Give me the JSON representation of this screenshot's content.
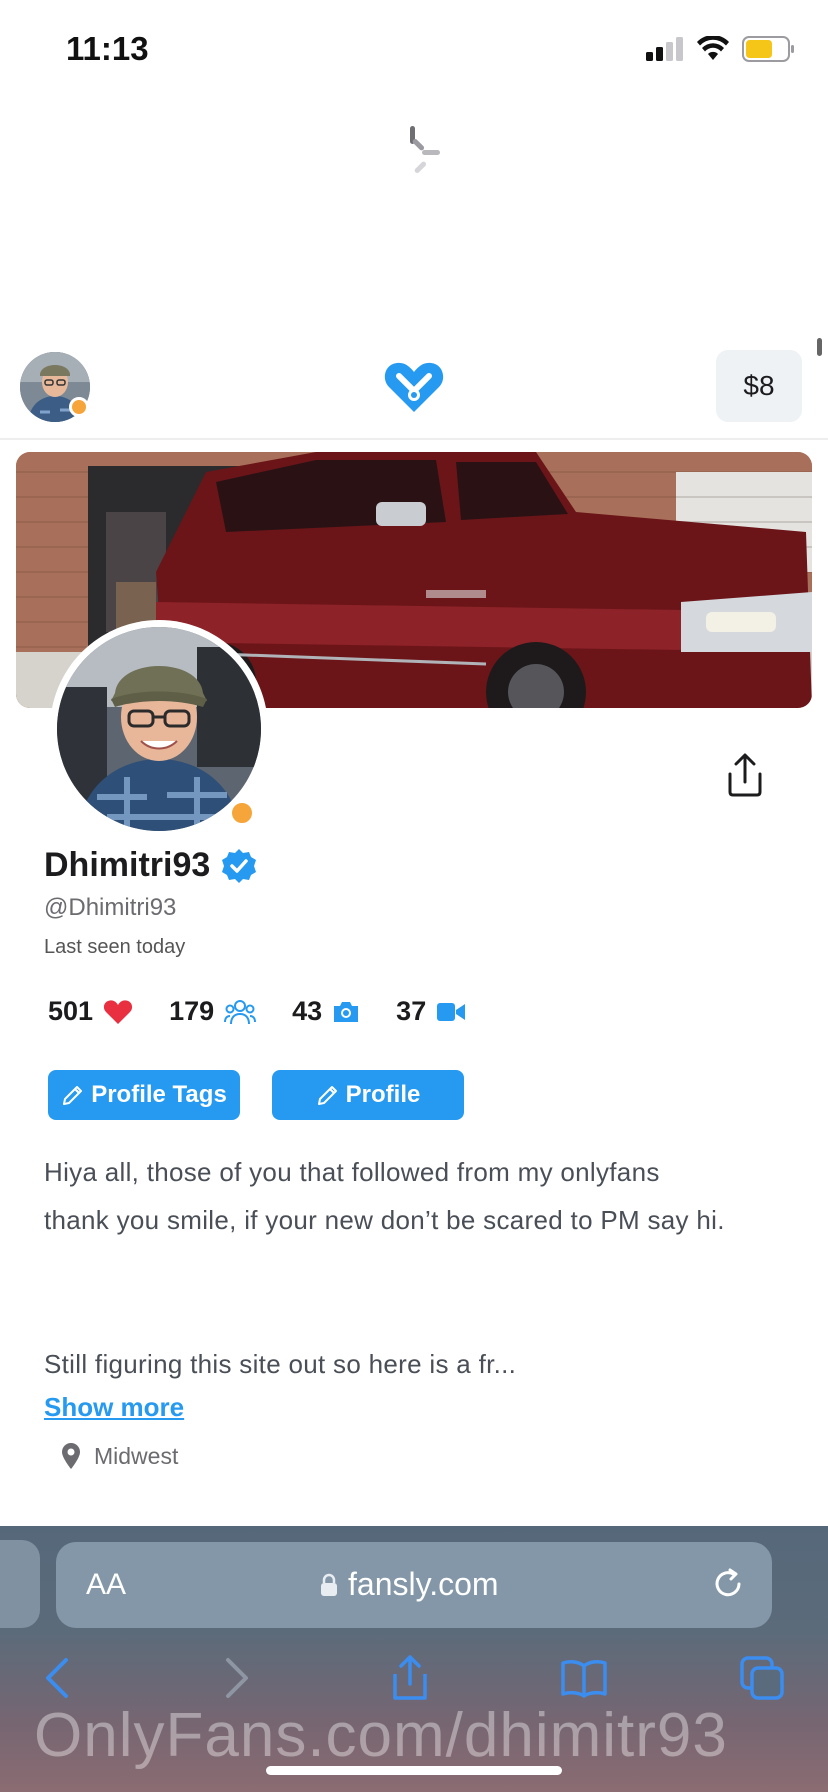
{
  "status_bar": {
    "time": "11:13",
    "battery_color": "#f5c518"
  },
  "nav": {
    "wallet_label": "$8",
    "brand_color": "#2699f0"
  },
  "profile": {
    "display_name": "Dhimitri93",
    "handle": "@Dhimitri93",
    "last_seen": "Last seen today",
    "verified": true,
    "status_color": "#f5a53a"
  },
  "stats": [
    {
      "value": "501",
      "icon": "heart-icon"
    },
    {
      "value": "179",
      "icon": "followers-icon"
    },
    {
      "value": "43",
      "icon": "camera-icon"
    },
    {
      "value": "37",
      "icon": "video-icon"
    }
  ],
  "buttons": {
    "profile_tags": "Profile Tags",
    "profile": "Profile"
  },
  "bio": {
    "line1": "Hiya all, those of you that followed from my onlyfans",
    "line2": "thank you smile, if your new don’t be scared to PM say hi.",
    "line3": "Still figuring this site out so here is a fr..."
  },
  "show_more": "Show more",
  "location": "Midwest",
  "browser": {
    "aa_label": "AA",
    "url": "fansly.com"
  },
  "watermark": "OnlyFans.com/dhimitr93"
}
